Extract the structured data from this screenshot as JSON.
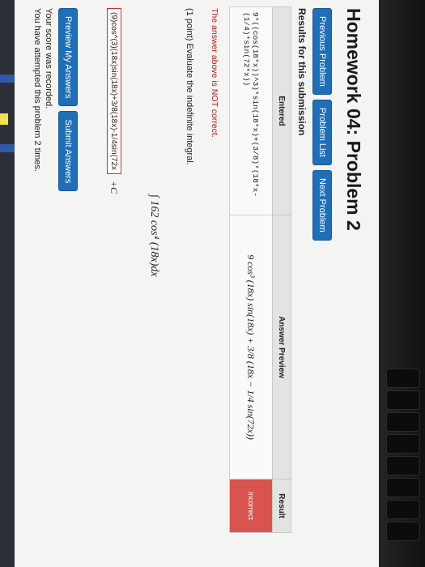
{
  "page": {
    "title": "Homework 04: Problem 2",
    "nav": {
      "previous": "Previous Problem",
      "list": "Problem List",
      "next": "Next Problem"
    },
    "results_heading": "Results for this submission",
    "table": {
      "headers": {
        "entered": "Entered",
        "preview": "Answer Preview",
        "result": "Result"
      },
      "row": {
        "entered": "9*((cos(18*x))^3)*sin(18*x)+(3/8)*(18*x-(1/4)*sin(72*x))",
        "preview": "9 cos³ (18x) sin(18x) + 3/8 (18x − 1/4 sin(72x))",
        "result": "incorrect"
      }
    },
    "notice": "The answer above is NOT correct.",
    "prompt": "(1 point) Evaluate the indefinite integral.",
    "integral": "∫ 162 cos⁴ (18x)dx",
    "answer": {
      "value": "(9)cos^(3)(18x)sin(18x)+3/8(18x)-1/4sin(72x))",
      "suffix": "+C"
    },
    "actions": {
      "preview": "Preview My Answers",
      "submit": "Submit Answers"
    },
    "status": {
      "recorded": "Your score was recorded.",
      "attempts": "You have attempted this problem 2 times."
    }
  },
  "colors": {
    "button_blue": "#1f6fb8",
    "incorrect_red": "#d9534f",
    "notice_red": "#b11b1b"
  }
}
